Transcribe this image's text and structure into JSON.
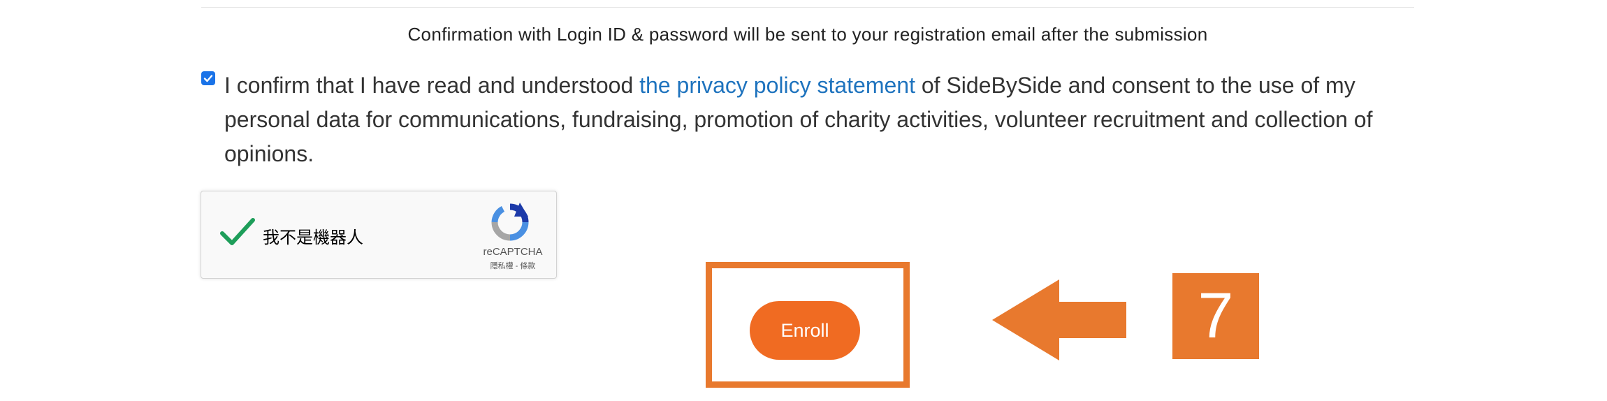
{
  "form": {
    "confirmation_note": "Confirmation with Login ID & password will be sent to your registration email after the submission",
    "consent": {
      "checked": true,
      "text_before": "I confirm that I have read and understood ",
      "link_text": "the privacy policy statement",
      "text_after": " of SideBySide and consent to the use of my personal data for communications, fundraising, promotion of charity activities, volunteer recruitment and collection of opinions."
    },
    "recaptcha": {
      "label": "我不是機器人",
      "brand": "reCAPTCHA",
      "terms": "隱私權 - 條款",
      "check_icon": "checkmark-icon",
      "logo_icon": "recaptcha-logo-icon"
    },
    "enroll_label": "Enroll"
  },
  "annotation": {
    "step_number": "7",
    "arrow_icon": "arrow-left-icon",
    "color": "#e8792e"
  },
  "colors": {
    "link": "#1e73be",
    "button": "#f06b22",
    "checkbox": "#1a73e8",
    "recaptcha_check": "#1e9e5a"
  }
}
